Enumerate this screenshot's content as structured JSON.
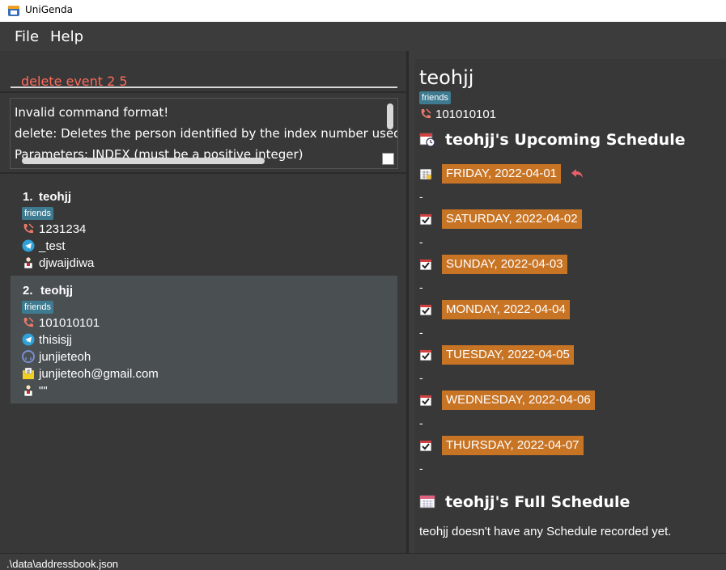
{
  "window": {
    "title": "UniGenda"
  },
  "menu": {
    "file": "File",
    "help": "Help"
  },
  "command": {
    "value": "delete event 2 5"
  },
  "result": {
    "lines": [
      "Invalid command format!",
      "delete: Deletes the person identified by the index number used",
      "Parameters: INDEX (must be a positive integer)"
    ]
  },
  "persons": [
    {
      "index": "1.",
      "name": "teohjj",
      "tag": "friends",
      "phone": "1231234",
      "telegram": "_test",
      "remark": "djwaijdiwa"
    },
    {
      "index": "2.",
      "name": "teohjj",
      "tag": "friends",
      "phone": "101010101",
      "telegram": "thisisjj",
      "github": "junjieteoh",
      "email": "junjieteoh@gmail.com",
      "remark": "\"\""
    }
  ],
  "detail": {
    "name": "teohjj",
    "tag": "friends",
    "phone": "101010101",
    "upcoming_title": "teohjj's Upcoming Schedule",
    "days": [
      {
        "label": "FRIDAY, 2022-04-01",
        "events": "-"
      },
      {
        "label": "SATURDAY, 2022-04-02",
        "events": "-"
      },
      {
        "label": "SUNDAY, 2022-04-03",
        "events": "-"
      },
      {
        "label": "MONDAY, 2022-04-04",
        "events": "-"
      },
      {
        "label": "TUESDAY, 2022-04-05",
        "events": "-"
      },
      {
        "label": "WEDNESDAY, 2022-04-06",
        "events": "-"
      },
      {
        "label": "THURSDAY, 2022-04-07",
        "events": "-"
      }
    ],
    "full_title": "teohjj's Full Schedule",
    "full_empty": "teohjj doesn't have any Schedule recorded yet."
  },
  "status": {
    "path": ".\\data\\addressbook.json"
  },
  "colors": {
    "tag": "#3e7b91",
    "day_highlight": "#c87425",
    "error_text": "#ff6a5c"
  }
}
